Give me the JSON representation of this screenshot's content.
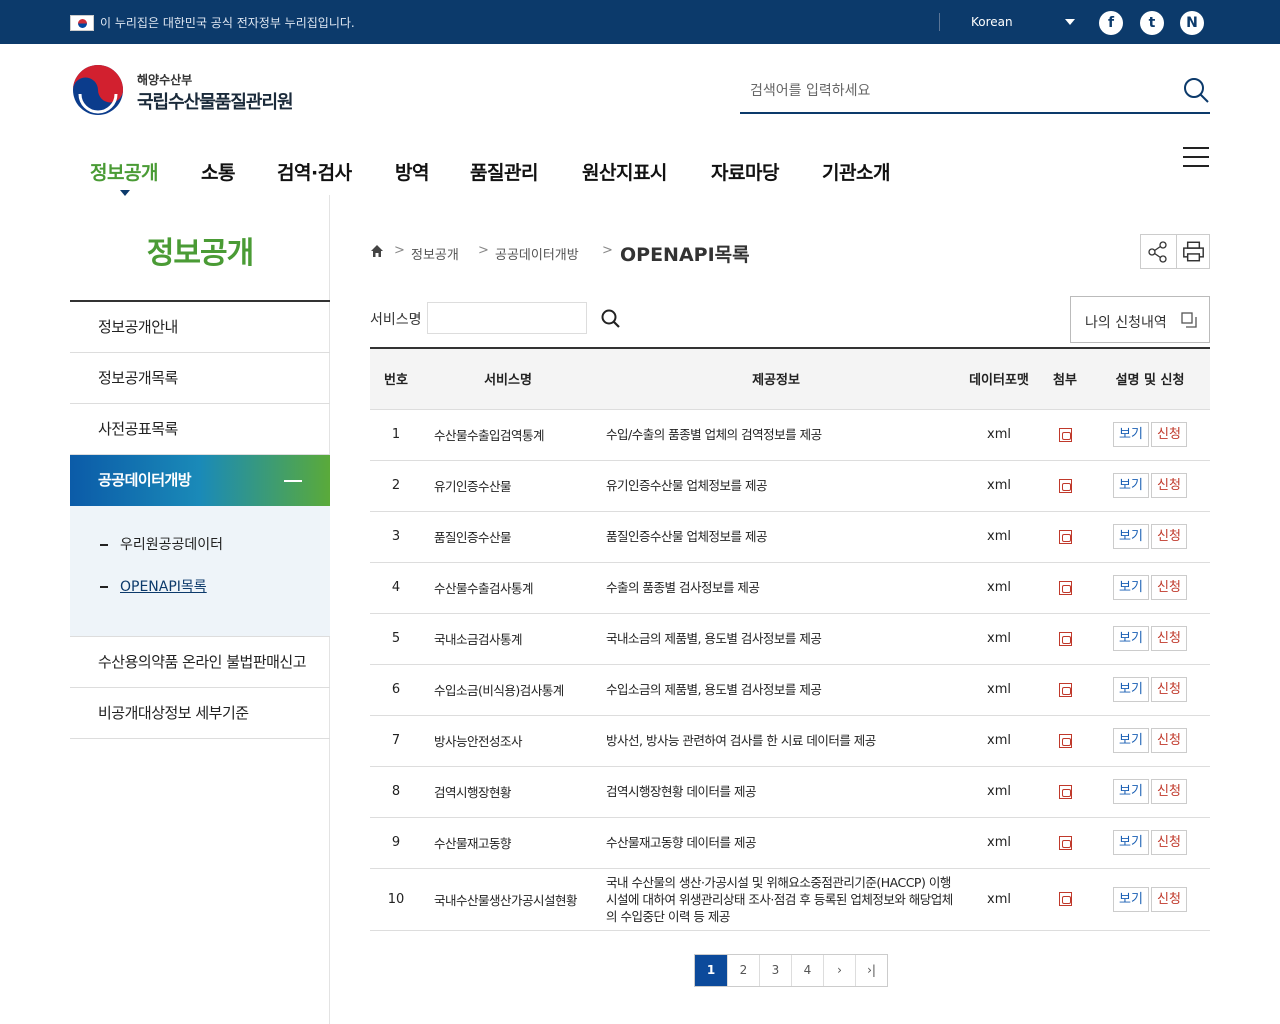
{
  "govbar": {
    "notice": "이 누리집은 대한민국 공식 전자정부 누리집입니다.",
    "language": "Korean",
    "sns": [
      {
        "name": "facebook-icon",
        "glyph": "f"
      },
      {
        "name": "twitter-icon",
        "glyph": "t"
      },
      {
        "name": "naver-blog-icon",
        "glyph": "N"
      }
    ]
  },
  "header": {
    "ministry": "해양수산부",
    "institution": "국립수산물품질관리원",
    "search_placeholder": "검색어를 입력하세요"
  },
  "gnb": {
    "items": [
      "정보공개",
      "소통",
      "검역·검사",
      "방역",
      "품질관리",
      "원산지표시",
      "자료마당",
      "기관소개"
    ],
    "active_index": 0
  },
  "lnb": {
    "title": "정보공개",
    "items": [
      "정보공개안내",
      "정보공개목록",
      "사전공표목록",
      "공공데이터개방",
      "수산용의약품 온라인 불법판매신고",
      "비공개대상정보 세부기준"
    ],
    "active_index": 3,
    "sub_items": [
      "우리원공공데이터",
      "OPENAPI목록"
    ],
    "active_sub_index": 1
  },
  "breadcrumb": {
    "level1": "정보공개",
    "level2": "공공데이터개방",
    "current": "OPENAPI목록"
  },
  "filter": {
    "label": "서비스명",
    "value": "",
    "my_requests": "나의 신청내역"
  },
  "table": {
    "headers": [
      "번호",
      "서비스명",
      "제공정보",
      "데이터포맷",
      "첨부",
      "설명 및 신청"
    ],
    "view_label": "보기",
    "apply_label": "신청",
    "rows": [
      {
        "no": "1",
        "name": "수산물수출입검역통계",
        "desc": "수입/수출의 품종별 업체의 검역정보를 제공",
        "format": "xml"
      },
      {
        "no": "2",
        "name": "유기인증수산물",
        "desc": "유기인증수산물 업체정보를 제공",
        "format": "xml"
      },
      {
        "no": "3",
        "name": "품질인증수산물",
        "desc": "품질인증수산물 업체정보를 제공",
        "format": "xml"
      },
      {
        "no": "4",
        "name": "수산물수출검사통계",
        "desc": "수출의 품종별 검사정보를 제공",
        "format": "xml"
      },
      {
        "no": "5",
        "name": "국내소금검사통계",
        "desc": "국내소금의 제품별, 용도별 검사정보를 제공",
        "format": "xml"
      },
      {
        "no": "6",
        "name": "수입소금(비식용)검사통계",
        "desc": "수입소금의 제품별, 용도별 검사정보를 제공",
        "format": "xml"
      },
      {
        "no": "7",
        "name": "방사능안전성조사",
        "desc": "방사선, 방사능 관련하여 검사를 한 시료 데이터를 제공",
        "format": "xml"
      },
      {
        "no": "8",
        "name": "검역시행장현황",
        "desc": "검역시행장현황 데이터를 제공",
        "format": "xml"
      },
      {
        "no": "9",
        "name": "수산물재고동향",
        "desc": "수산물재고동향 데이터를 제공",
        "format": "xml"
      },
      {
        "no": "10",
        "name": "국내수산물생산가공시설현황",
        "desc": "국내 수산물의 생산·가공시설 및 위해요소중점관리기준(HACCP) 이행시설에 대하여 위생관리상태 조사·점검 후 등록된 업체정보와 해당업체의 수입중단 이력 등 제공",
        "format": "xml"
      }
    ]
  },
  "pagination": {
    "pages": [
      "1",
      "2",
      "3",
      "4"
    ],
    "current": "1",
    "next": "›",
    "last": "›|"
  }
}
